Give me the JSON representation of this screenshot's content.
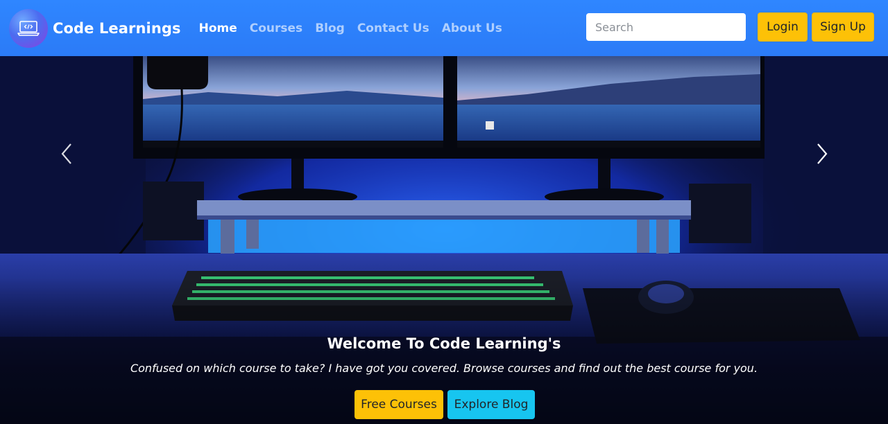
{
  "brand": {
    "name": "Code Learnings",
    "logo_icon": "laptop-code-icon"
  },
  "nav": {
    "links": [
      {
        "label": "Home",
        "active": true
      },
      {
        "label": "Courses",
        "active": false
      },
      {
        "label": "Blog",
        "active": false
      },
      {
        "label": "Contact Us",
        "active": false
      },
      {
        "label": "About Us",
        "active": false
      }
    ]
  },
  "search": {
    "placeholder": "Search",
    "value": ""
  },
  "auth": {
    "login_label": "Login",
    "signup_label": "Sign Up"
  },
  "hero": {
    "title": "Welcome To Code Learning's",
    "subtitle": "Confused on which course to take? I have got you covered. Browse courses and find out the best course for you.",
    "primary_button": "Free Courses",
    "secondary_button": "Explore Blog",
    "prev_icon": "chevron-left-icon",
    "next_icon": "chevron-right-icon"
  },
  "colors": {
    "navbar": "#2f86ff",
    "warning": "#fdc107",
    "info": "#17c5f0",
    "hero_glow": "#1a3cff"
  }
}
